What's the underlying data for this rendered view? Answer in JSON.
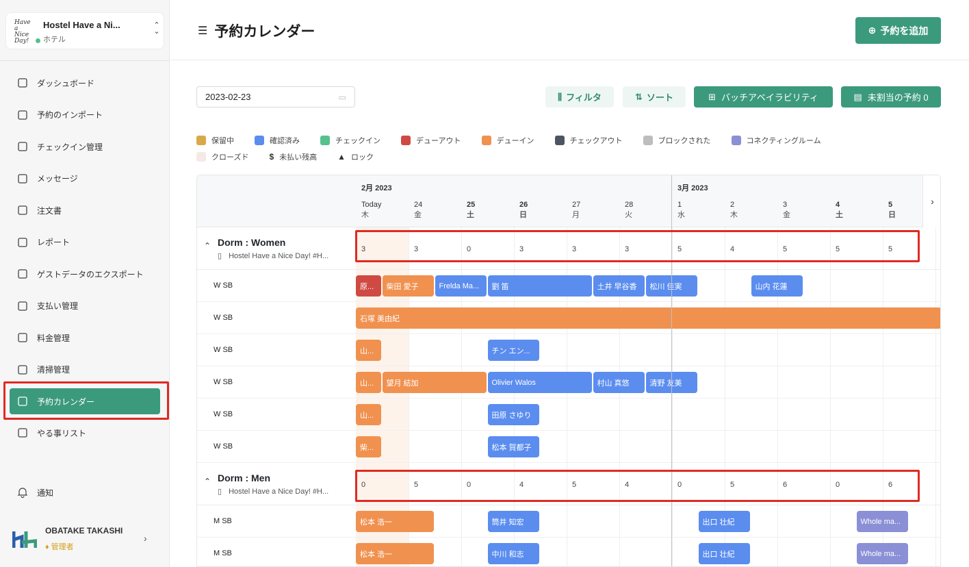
{
  "hotel": {
    "name": "Hostel Have a Ni...",
    "type": "ホテル",
    "logo_text": "Have a Nice Day!"
  },
  "nav": [
    {
      "label": "ダッシュボード",
      "icon": "dashboard-icon"
    },
    {
      "label": "予約のインポート",
      "icon": "import-icon"
    },
    {
      "label": "チェックイン管理",
      "icon": "checkin-icon"
    },
    {
      "label": "メッセージ",
      "icon": "message-icon"
    },
    {
      "label": "注文書",
      "icon": "order-icon"
    },
    {
      "label": "レポート",
      "icon": "report-icon"
    },
    {
      "label": "ゲストデータのエクスポート",
      "icon": "export-icon"
    },
    {
      "label": "支払い管理",
      "icon": "payment-icon"
    },
    {
      "label": "料金管理",
      "icon": "pricing-icon"
    },
    {
      "label": "清掃管理",
      "icon": "cleaning-icon"
    },
    {
      "label": "予約カレンダー",
      "icon": "calendar-icon",
      "active": true
    },
    {
      "label": "やる事リスト",
      "icon": "todo-icon"
    }
  ],
  "notify_label": "通知",
  "user": {
    "name": "OBATAKE TAKASHI",
    "role": "管理者"
  },
  "header": {
    "title": "予約カレンダー",
    "add_label": "予約を追加"
  },
  "toolbar": {
    "date": "2023-02-23",
    "filter": "フィルタ",
    "sort": "ソート",
    "batch": "バッチアベイラビリティ",
    "unassigned": "未割当の予約 0"
  },
  "legend": [
    {
      "label": "保留中",
      "color": "#d8a84a"
    },
    {
      "label": "確認済み",
      "color": "#5b8def"
    },
    {
      "label": "チェックイン",
      "color": "#57c18d"
    },
    {
      "label": "デューアウト",
      "color": "#cf4a42"
    },
    {
      "label": "デューイン",
      "color": "#f0914f"
    },
    {
      "label": "チェックアウト",
      "color": "#4e5562"
    },
    {
      "label": "ブロックされた",
      "color": "#bdbdbd"
    },
    {
      "label": "コネクティングルーム",
      "color": "#8a8fd6"
    },
    {
      "label": "クローズド",
      "color": "#f5e9e6"
    },
    {
      "label": "未払い残高",
      "color": "#333333",
      "icon": "dollar-icon"
    },
    {
      "label": "ロック",
      "color": "#333333",
      "icon": "lock-icon"
    }
  ],
  "months": [
    {
      "label": "2月 2023"
    },
    {
      "label": "3月 2023"
    }
  ],
  "days": [
    {
      "d": "Today",
      "w": "木",
      "bold": false
    },
    {
      "d": "24",
      "w": "金",
      "bold": false
    },
    {
      "d": "25",
      "w": "土",
      "bold": true
    },
    {
      "d": "26",
      "w": "日",
      "bold": true
    },
    {
      "d": "27",
      "w": "月",
      "bold": false
    },
    {
      "d": "28",
      "w": "火",
      "bold": false
    },
    {
      "d": "1",
      "w": "水",
      "bold": false
    },
    {
      "d": "2",
      "w": "木",
      "bold": false
    },
    {
      "d": "3",
      "w": "金",
      "bold": false
    },
    {
      "d": "4",
      "w": "土",
      "bold": true
    },
    {
      "d": "5",
      "w": "日",
      "bold": true
    }
  ],
  "groups": [
    {
      "title": "Dorm : Women",
      "sub": "Hostel Have a Nice Day! #H...",
      "counts": [
        "3",
        "3",
        "0",
        "3",
        "3",
        "3",
        "5",
        "4",
        "5",
        "5",
        "5"
      ],
      "rooms": [
        {
          "label": "W SB",
          "bars": [
            {
              "text": "原...",
              "start": 0,
              "span": 0.5,
              "color": "red"
            },
            {
              "text": "柴田 愛子",
              "start": 0.5,
              "span": 1.0,
              "color": "orange"
            },
            {
              "text": "Frelda Ma...",
              "start": 1.5,
              "span": 1.0,
              "color": "blue"
            },
            {
              "text": "劉 笛",
              "start": 2.5,
              "span": 2.0,
              "color": "blue"
            },
            {
              "text": "土井 早谷香",
              "start": 4.5,
              "span": 1.0,
              "color": "blue"
            },
            {
              "text": "松川 佳実",
              "start": 5.5,
              "span": 1.0,
              "color": "blue"
            },
            {
              "text": "山内 花蓮",
              "start": 7.5,
              "span": 1.0,
              "color": "blue"
            }
          ]
        },
        {
          "label": "W SB",
          "bars": [
            {
              "text": "石塚 美由紀",
              "start": 0,
              "span": 11.2,
              "color": "orange"
            }
          ]
        },
        {
          "label": "W SB",
          "bars": [
            {
              "text": "山...",
              "start": 0,
              "span": 0.5,
              "color": "orange"
            },
            {
              "text": "チン エン...",
              "start": 2.5,
              "span": 1.0,
              "color": "blue"
            }
          ]
        },
        {
          "label": "W SB",
          "bars": [
            {
              "text": "山...",
              "start": 0,
              "span": 0.5,
              "color": "orange"
            },
            {
              "text": "望月 結加",
              "start": 0.5,
              "span": 2.0,
              "color": "orange"
            },
            {
              "text": "Olivier Walos",
              "start": 2.5,
              "span": 2.0,
              "color": "blue"
            },
            {
              "text": "村山 真悠",
              "start": 4.5,
              "span": 1.0,
              "color": "blue"
            },
            {
              "text": "清野 友美",
              "start": 5.5,
              "span": 1.0,
              "color": "blue"
            }
          ]
        },
        {
          "label": "W SB",
          "bars": [
            {
              "text": "山...",
              "start": 0,
              "span": 0.5,
              "color": "orange"
            },
            {
              "text": "田原 さゆり",
              "start": 2.5,
              "span": 1.0,
              "color": "blue"
            }
          ]
        },
        {
          "label": "W SB",
          "bars": [
            {
              "text": "柴...",
              "start": 0,
              "span": 0.5,
              "color": "orange"
            },
            {
              "text": "松本 賀都子",
              "start": 2.5,
              "span": 1.0,
              "color": "blue"
            }
          ]
        }
      ]
    },
    {
      "title": "Dorm : Men",
      "sub": "Hostel Have a Nice Day! #H...",
      "counts": [
        "0",
        "5",
        "0",
        "4",
        "5",
        "4",
        "0",
        "5",
        "6",
        "0",
        "6"
      ],
      "rooms": [
        {
          "label": "M SB",
          "bars": [
            {
              "text": "松本 浩一",
              "start": 0,
              "span": 1.5,
              "color": "orange"
            },
            {
              "text": "筒井 知宏",
              "start": 2.5,
              "span": 1.0,
              "color": "blue"
            },
            {
              "text": "出口 壮紀",
              "start": 6.5,
              "span": 1.0,
              "color": "blue"
            },
            {
              "text": "Whole ma...",
              "start": 9.5,
              "span": 1.0,
              "color": "purple"
            }
          ]
        },
        {
          "label": "M SB",
          "bars": [
            {
              "text": "松本 浩一",
              "start": 0,
              "span": 1.5,
              "color": "orange"
            },
            {
              "text": "中川 和志",
              "start": 2.5,
              "span": 1.0,
              "color": "blue"
            },
            {
              "text": "出口 壮紀",
              "start": 6.5,
              "span": 1.0,
              "color": "blue"
            },
            {
              "text": "Whole ma...",
              "start": 9.5,
              "span": 1.0,
              "color": "purple"
            }
          ]
        }
      ]
    }
  ]
}
